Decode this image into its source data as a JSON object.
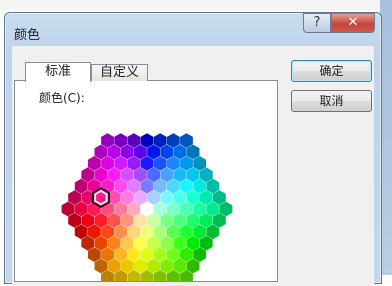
{
  "dialog": {
    "title": "颜色",
    "help_icon": "question-mark-icon",
    "help_glyph": "?",
    "close_icon": "close-x-icon",
    "close_glyph": "✕"
  },
  "tabs": [
    {
      "label": "标准",
      "active": true
    },
    {
      "label": "自定义",
      "active": false
    }
  ],
  "palette": {
    "label": "颜色(C):",
    "selected_color": "#00b050"
  },
  "buttons": {
    "ok_label": "确定",
    "cancel_label": "取消"
  }
}
